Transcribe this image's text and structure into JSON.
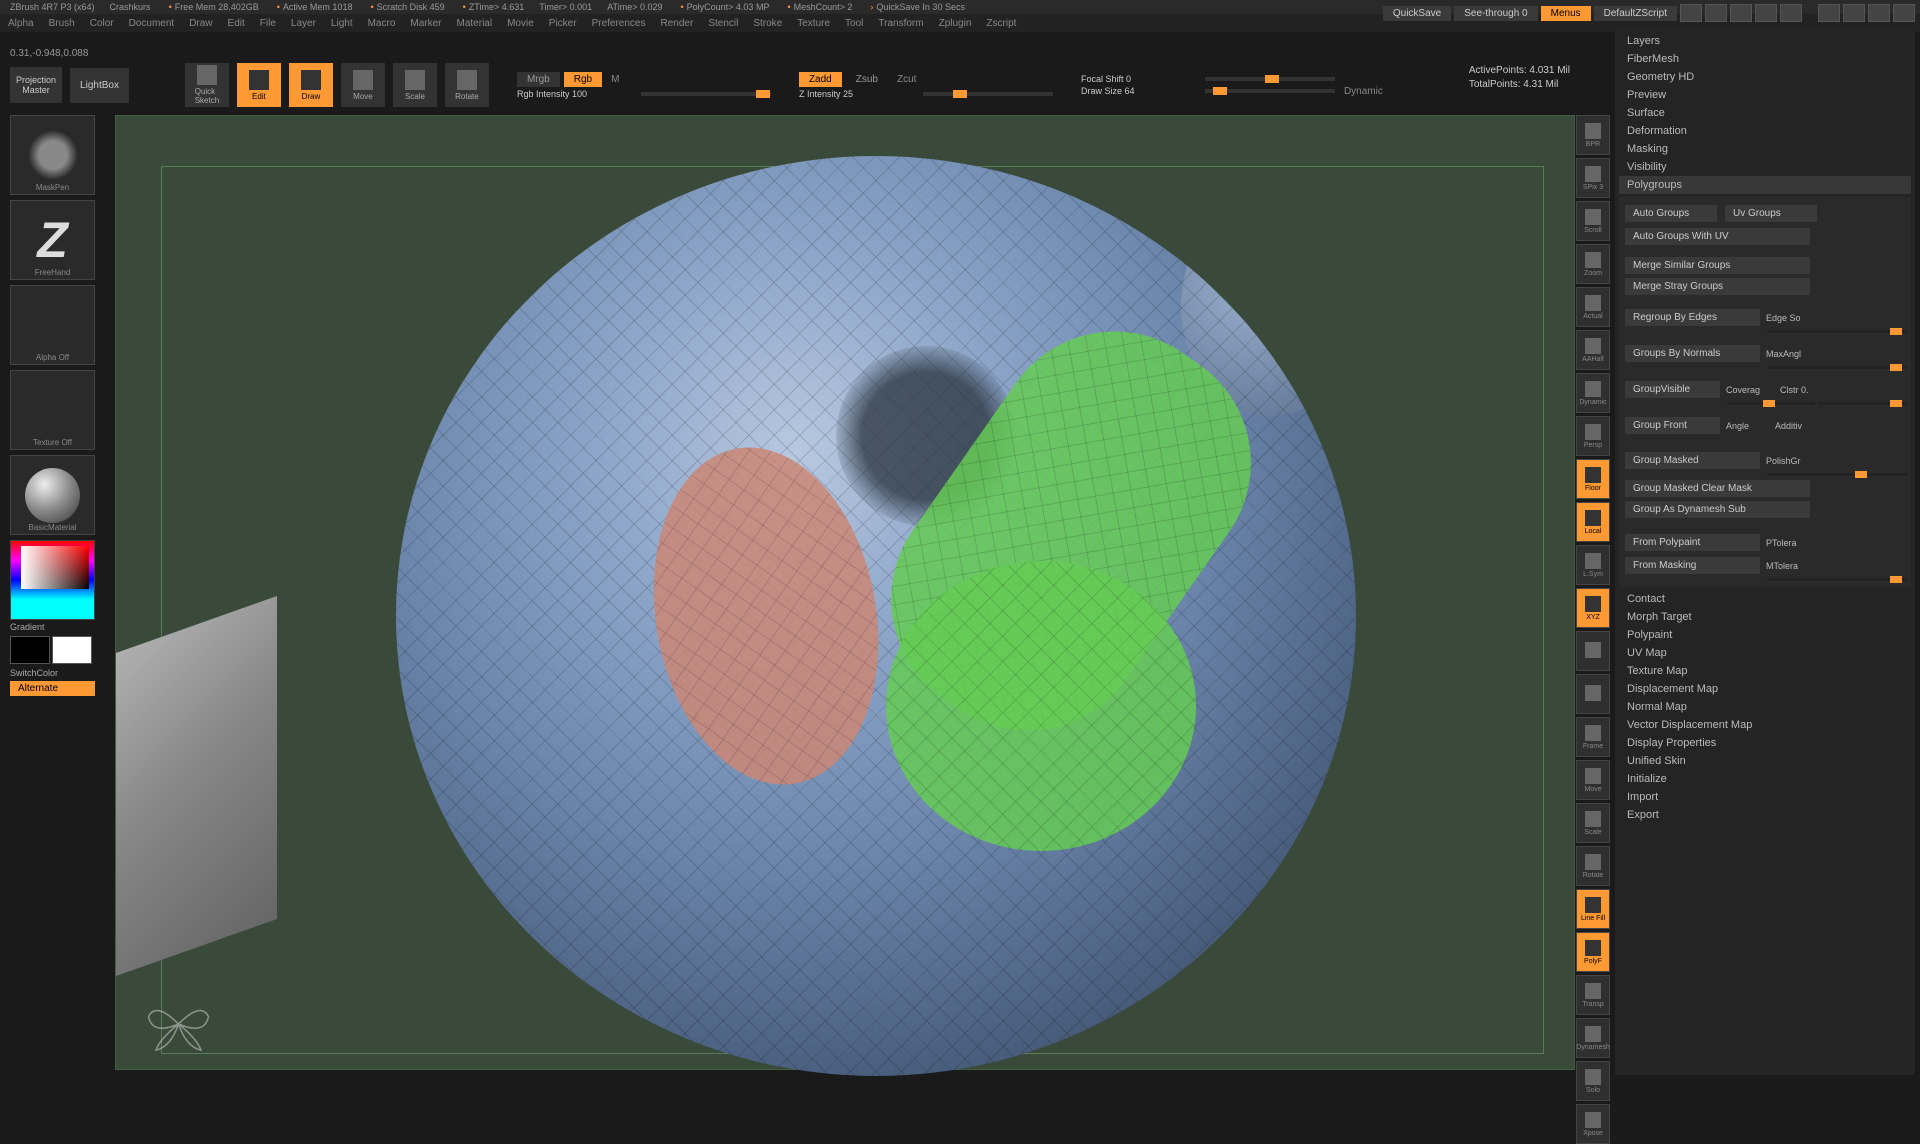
{
  "status": {
    "app": "ZBrush 4R7 P3 (x64)",
    "project": "Crashkurs",
    "freeMem": "Free Mem 28.402GB",
    "activeMem": "Active Mem 1018",
    "scratchDisk": "Scratch Disk 459",
    "ztime": "ZTime> 4.631",
    "timer": "Timer> 0.001",
    "atime": "ATime> 0.029",
    "polycount": "PolyCount> 4.03 MP",
    "meshcount": "MeshCount> 2",
    "quicksave": "QuickSave In 30 Secs"
  },
  "topRight": {
    "quicksave": "QuickSave",
    "seethrough": "See-through  0",
    "menus": "Menus",
    "defaultScript": "DefaultZScript"
  },
  "menus": [
    "Alpha",
    "Brush",
    "Color",
    "Document",
    "Draw",
    "Edit",
    "File",
    "Layer",
    "Light",
    "Macro",
    "Marker",
    "Material",
    "Movie",
    "Picker",
    "Preferences",
    "Render",
    "Stencil",
    "Stroke",
    "Texture",
    "Tool",
    "Transform",
    "Zplugin",
    "Zscript"
  ],
  "coords": "0.31,-0.948,0.088",
  "projMaster": "Projection\nMaster",
  "lightbox": "LightBox",
  "toolBtns": {
    "quickSketch": "Quick\nSketch",
    "edit": "Edit",
    "draw": "Draw",
    "move": "Move",
    "scale": "Scale",
    "rotate": "Rotate"
  },
  "modes": {
    "mrgb": "Mrgb",
    "rgb": "Rgb",
    "m": "M",
    "rgbIntensity": "Rgb Intensity 100",
    "zadd": "Zadd",
    "zsub": "Zsub",
    "zcut": "Zcut",
    "zIntensity": "Z Intensity 25",
    "focalShift": "Focal Shift 0",
    "drawSize": "Draw Size 64",
    "dynamic": "Dynamic"
  },
  "stats": {
    "active": "ActivePoints: 4.031 Mil",
    "total": "TotalPoints: 4.31 Mil"
  },
  "leftPanel": {
    "brush": "MaskPen",
    "stroke": "FreeHand",
    "alpha": "Alpha Off",
    "texture": "Texture Off",
    "material": "BasicMaterial",
    "gradient": "Gradient",
    "switchColor": "SwitchColor",
    "alternate": "Alternate"
  },
  "sideIcons": [
    "BPR",
    "SPix 3",
    "Scroll",
    "Zoom",
    "Actual",
    "AAHalf",
    "Dynamic",
    "Persp",
    "Floor",
    "Local",
    "L.Sym",
    "XYZ",
    "",
    "",
    "Frame",
    "Move",
    "Scale",
    "Rotate",
    "Line Fill",
    "PolyF",
    "Transp",
    "Dynamesh",
    "Solo",
    "Xpose"
  ],
  "sideActive": [
    8,
    9,
    11,
    18,
    19
  ],
  "rightPanel": {
    "sections": [
      "Layers",
      "FiberMesh",
      "Geometry HD",
      "Preview",
      "Surface",
      "Deformation",
      "Masking",
      "Visibility"
    ],
    "polygroups": {
      "title": "Polygroups",
      "autoGroups": "Auto Groups",
      "uvGroups": "Uv Groups",
      "autoGroupsUV": "Auto Groups With UV",
      "mergeSimilar": "Merge Similar Groups",
      "mergeStray": "Merge Stray Groups",
      "regroupEdges": "Regroup By Edges",
      "edgeSoft": "Edge So",
      "groupsNormals": "Groups By Normals",
      "maxAngle": "MaxAngl",
      "groupVisible": "GroupVisible",
      "coverage": "Coverag",
      "clstr": "Clstr 0.",
      "groupFront": "Group Front",
      "angle": "Angle",
      "additive": "Additiv",
      "groupMasked": "Group Masked",
      "polishGroups": "PolishGr",
      "groupMaskedClear": "Group Masked Clear Mask",
      "groupDynamesh": "Group As Dynamesh Sub",
      "fromPolypaint": "From Polypaint",
      "ptolerance": "PTolera",
      "fromMasking": "From Masking",
      "mtolerance": "MTolera"
    },
    "sectionsAfter": [
      "Contact",
      "Morph Target",
      "Polypaint",
      "UV Map",
      "Texture Map",
      "Displacement Map",
      "Normal Map",
      "Vector Displacement Map",
      "Display Properties",
      "Unified Skin",
      "Initialize",
      "Import",
      "Export"
    ]
  }
}
